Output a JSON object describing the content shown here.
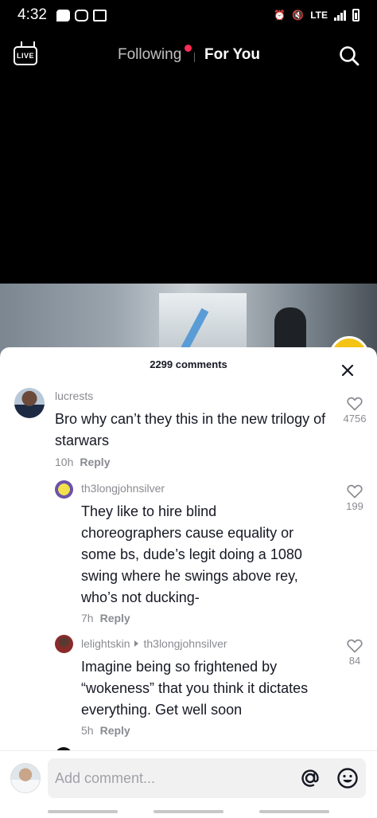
{
  "status_bar": {
    "time": "4:32",
    "network": "LTE"
  },
  "top_nav": {
    "live_label": "LIVE",
    "tab_following": "Following",
    "tab_for_you": "For You"
  },
  "comments_sheet": {
    "title": "2299 comments",
    "comments": [
      {
        "username": "lucrests",
        "text": "Bro why can’t they this in the new trilogy of starwars",
        "time": "10h",
        "reply_label": "Reply",
        "likes": "4756"
      },
      {
        "username": "th3longjohnsilver",
        "text": "They like to hire blind choreographers cause equality or some bs, dude’s legit doing a 1080 swing where he swings above rey, who’s not ducking-",
        "time": "7h",
        "reply_label": "Reply",
        "likes": "199"
      },
      {
        "username": "lelightskin",
        "reply_to": "th3longjohnsilver",
        "text": "Imagine being so frightened by “wokeness” that you think it dictates everything. Get well soon",
        "time": "5h",
        "reply_label": "Reply",
        "likes": "84"
      }
    ]
  },
  "input_bar": {
    "placeholder": "Add comment..."
  },
  "colors": {
    "accent_dot": "#fe2c55",
    "secondary_text": "#8a8b91",
    "primary_text": "#161823"
  }
}
